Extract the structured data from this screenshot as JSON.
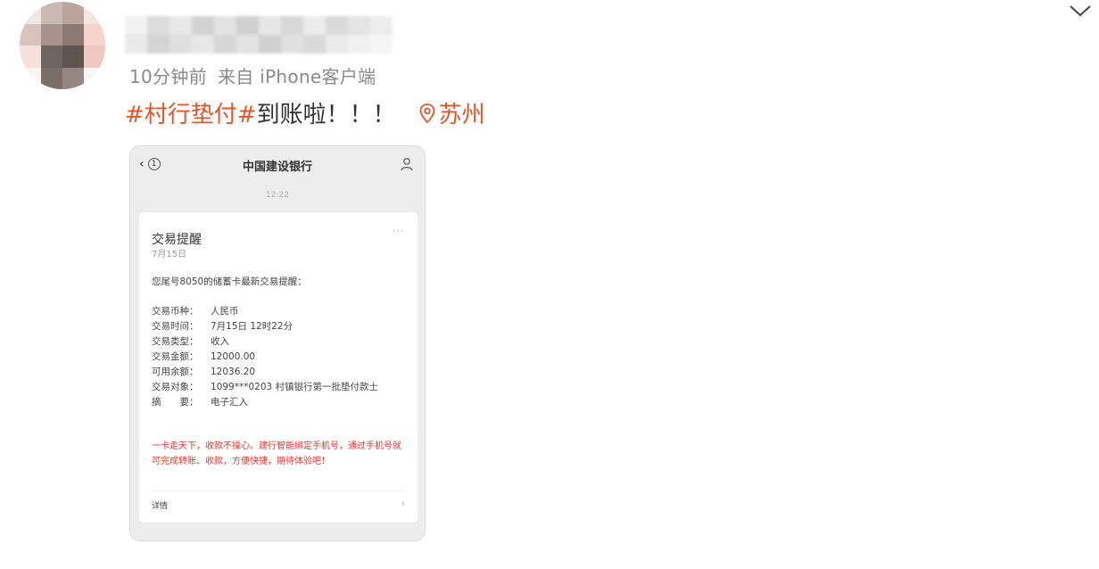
{
  "post": {
    "meta_time": "10分钟前",
    "meta_source": "来自 iPhone客户端",
    "hashtag": "#村行垫付#",
    "text": "到账啦！！！",
    "location": "苏州"
  },
  "screenshot": {
    "back_count": "1",
    "title": "中国建设银行",
    "time": "12:22",
    "card": {
      "title": "交易提醒",
      "date": "7月15日",
      "dots": "···",
      "notice": "您尾号8050的储蓄卡最新交易提醒：",
      "rows": [
        {
          "key": "交易币种：",
          "value": "人民币"
        },
        {
          "key": "交易时间：",
          "value": "7月15日 12时22分"
        },
        {
          "key": "交易类型：",
          "value": "收入"
        },
        {
          "key": "交易金额：",
          "value": "12000.00"
        },
        {
          "key": "可用余额：",
          "value": "12036.20"
        },
        {
          "key": "交易对象：",
          "value": "1099***0203 村镇银行第一批垫付款士"
        },
        {
          "key": "摘　　要：",
          "value": "电子汇入"
        }
      ],
      "warning": "一卡走天下，收款不操心。建行智能绑定手机号，通过手机号就可完成转账、收款，方便快捷，期待体验吧！",
      "detail": "详情",
      "chevron": "›"
    }
  },
  "colors": {
    "accent": "#e0582a",
    "meta": "#8a8a8a",
    "warning": "#e03a30"
  },
  "icons": {
    "collapse": "chevron-down-icon",
    "location": "location-pin-icon",
    "contact": "person-icon"
  }
}
